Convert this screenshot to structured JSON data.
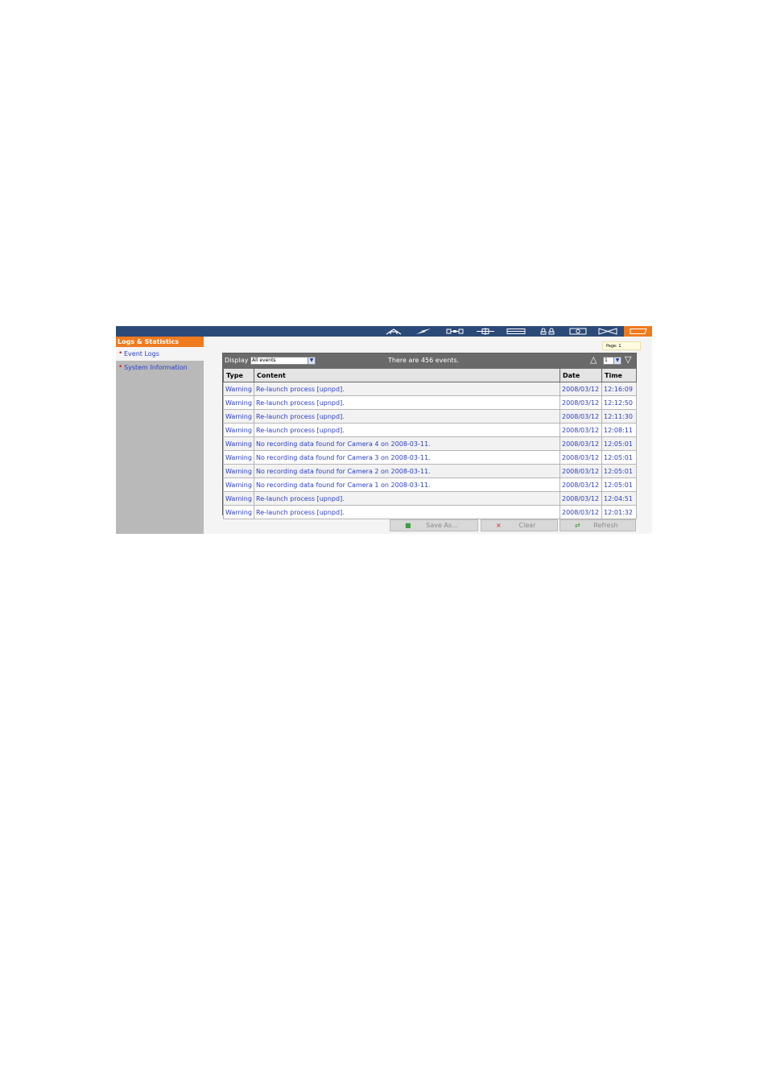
{
  "topbar": {
    "icons": [
      "home-icon",
      "wizard-icon",
      "network-icon",
      "device-icon",
      "disk-icon",
      "users-icon",
      "camera-icon",
      "network-share-icon",
      "logs-icon"
    ],
    "active_icon": "logs-icon",
    "accent_color": "#f07a1e",
    "bar_color": "#2c4a78"
  },
  "sidebar": {
    "title": "Logs & Statistics",
    "items": [
      {
        "label": "Event Logs"
      },
      {
        "label": "System Information"
      }
    ]
  },
  "page_badge": "Page: 1",
  "panel": {
    "display_label": "Display",
    "display_value": "All events",
    "event_count_text": "There are 456 events.",
    "page_value": "1",
    "columns": [
      "Type",
      "Content",
      "Date",
      "Time"
    ],
    "rows": [
      {
        "type": "Warning",
        "content": "Re-launch process [upnpd].",
        "date": "2008/03/12",
        "time": "12:16:09"
      },
      {
        "type": "Warning",
        "content": "Re-launch process [upnpd].",
        "date": "2008/03/12",
        "time": "12:12:50"
      },
      {
        "type": "Warning",
        "content": "Re-launch process [upnpd].",
        "date": "2008/03/12",
        "time": "12:11:30"
      },
      {
        "type": "Warning",
        "content": "Re-launch process [upnpd].",
        "date": "2008/03/12",
        "time": "12:08:11"
      },
      {
        "type": "Warning",
        "content": "No recording data found for Camera 4 on 2008-03-11.",
        "date": "2008/03/12",
        "time": "12:05:01"
      },
      {
        "type": "Warning",
        "content": "No recording data found for Camera 3 on 2008-03-11.",
        "date": "2008/03/12",
        "time": "12:05:01"
      },
      {
        "type": "Warning",
        "content": "No recording data found for Camera 2 on 2008-03-11.",
        "date": "2008/03/12",
        "time": "12:05:01"
      },
      {
        "type": "Warning",
        "content": "No recording data found for Camera 1 on 2008-03-11.",
        "date": "2008/03/12",
        "time": "12:05:01"
      },
      {
        "type": "Warning",
        "content": "Re-launch process [upnpd].",
        "date": "2008/03/12",
        "time": "12:04:51"
      },
      {
        "type": "Warning",
        "content": "Re-launch process [upnpd].",
        "date": "2008/03/12",
        "time": "12:01:32"
      }
    ]
  },
  "buttons": {
    "save_as": "Save As...",
    "clear": "Clear",
    "refresh": "Refresh"
  }
}
